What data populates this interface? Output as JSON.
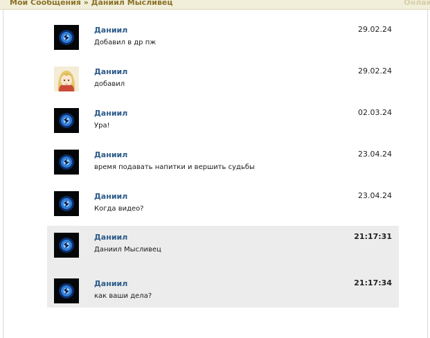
{
  "breadcrumb": {
    "text": "Мои Сообщения » Даниил Мысливец"
  },
  "status": {
    "text": "Онлайн"
  },
  "messages": [
    {
      "author": "Даниил",
      "text": "Добавил в др пж",
      "date": "29.02.24",
      "avatar": "blue-orb"
    },
    {
      "author": "Даниил",
      "text": "добавил",
      "date": "29.02.24",
      "avatar": "anime-girl"
    },
    {
      "author": "Даниил",
      "text": "Ура!",
      "date": "02.03.24",
      "avatar": "blue-orb"
    },
    {
      "author": "Даниил",
      "text": "время подавать напитки и вершить судьбы",
      "date": "23.04.24",
      "avatar": "blue-orb"
    },
    {
      "author": "Даниил",
      "text": "Когда видео?",
      "date": "23.04.24",
      "avatar": "blue-orb"
    },
    {
      "author": "Даниил",
      "text": "Даниил Мысливец",
      "date": "21:17:31",
      "avatar": "blue-orb"
    },
    {
      "author": "Даниил",
      "text": "как ваши дела?",
      "date": "21:17:34",
      "avatar": "blue-orb"
    }
  ],
  "colors": {
    "header_bg": "#f1eeda",
    "breadcrumb": "#8a7227",
    "author": "#2d5b8a",
    "highlight_bg": "#ececec"
  }
}
